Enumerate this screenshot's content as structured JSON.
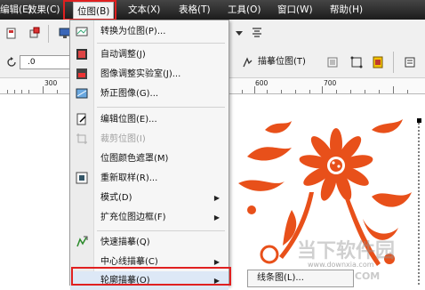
{
  "menubar": {
    "items": [
      {
        "label": "编辑(E)"
      },
      {
        "label": "效果(C)"
      },
      {
        "label": "位图(B)"
      },
      {
        "label": "文本(X)"
      },
      {
        "label": "表格(T)"
      },
      {
        "label": "工具(O)"
      },
      {
        "label": "窗口(W)"
      },
      {
        "label": "帮助(H)"
      }
    ]
  },
  "toolbar": {
    "rotation_value": ".0",
    "trace_bitmap_label": "描摹位图(T)"
  },
  "ruler": {
    "labels": [
      "300",
      "600",
      "700"
    ]
  },
  "bitmap_menu": {
    "items": [
      {
        "label": "转换为位图(P)...",
        "icon": "convert-bitmap-icon"
      },
      {
        "label": "自动调整(J)",
        "icon": "auto-adjust-icon"
      },
      {
        "label": "图像调整实验室(J)...",
        "icon": "image-lab-icon"
      },
      {
        "label": "矫正图像(G)...",
        "icon": "straighten-icon"
      },
      {
        "label": "编辑位图(E)...",
        "icon": "edit-bitmap-icon"
      },
      {
        "label": "裁剪位图(I)",
        "icon": "crop-bitmap-icon"
      },
      {
        "label": "位图颜色遮罩(M)",
        "icon": ""
      },
      {
        "label": "重新取样(R)...",
        "icon": "resample-icon"
      },
      {
        "label": "模式(D)",
        "icon": ""
      },
      {
        "label": "扩充位图边框(F)",
        "icon": ""
      },
      {
        "label": "快速描摹(Q)",
        "icon": "quick-trace-icon"
      },
      {
        "label": "中心线描摹(C)",
        "icon": ""
      },
      {
        "label": "轮廓描摹(O)",
        "icon": ""
      }
    ]
  },
  "submenu": {
    "first_item": "线条图(L)..."
  },
  "watermark": {
    "text": "当下软件园",
    "url": "www.downxia.com",
    "site": "XHLY S.COM"
  }
}
